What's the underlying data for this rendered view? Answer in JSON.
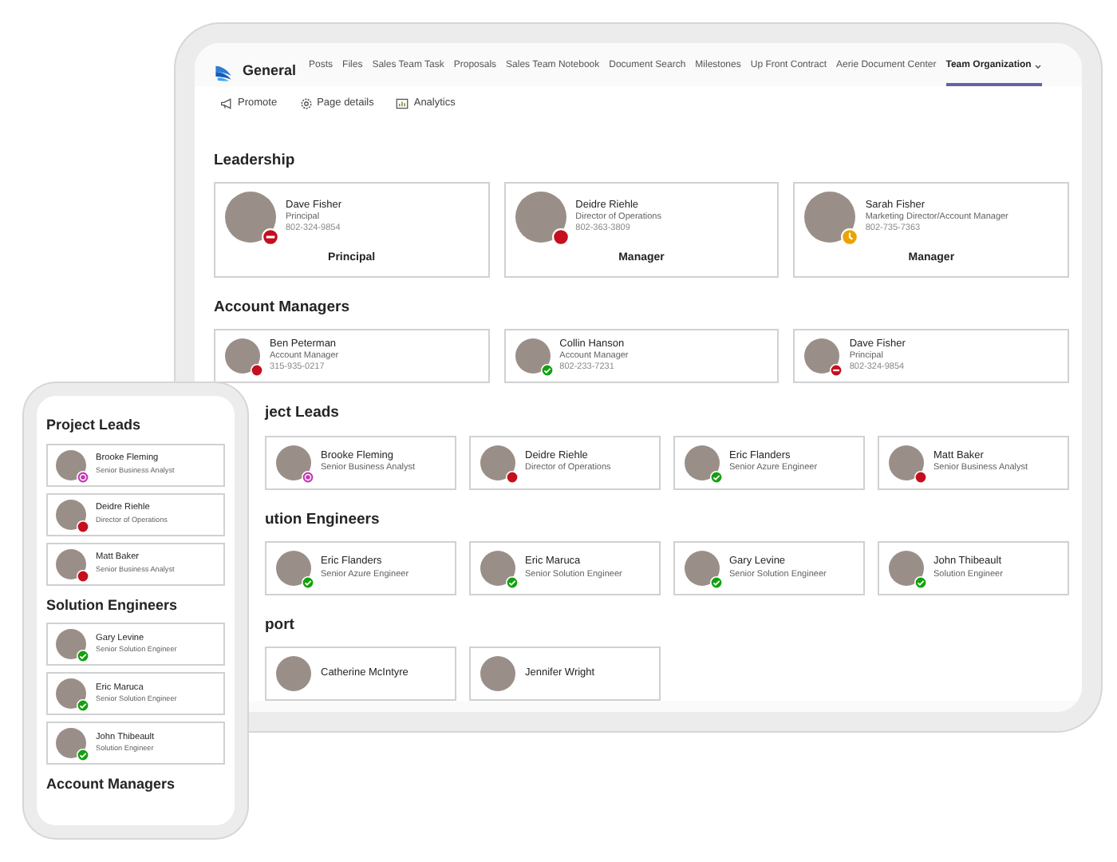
{
  "tablet": {
    "team_name": "General",
    "tabs": [
      {
        "label": "Posts",
        "selected": false
      },
      {
        "label": "Files",
        "selected": false
      },
      {
        "label": "Sales Team Task",
        "selected": false
      },
      {
        "label": "Proposals",
        "selected": false
      },
      {
        "label": "Sales Team Notebook",
        "selected": false
      },
      {
        "label": "Document Search",
        "selected": false
      },
      {
        "label": "Milestones",
        "selected": false
      },
      {
        "label": "Up Front Contract",
        "selected": false
      },
      {
        "label": "Aerie Document Center",
        "selected": false
      },
      {
        "label": "Team Organization",
        "selected": true
      }
    ],
    "toolbar": [
      {
        "kind": "promote",
        "label": "Promote"
      },
      {
        "kind": "details",
        "label": "Page details"
      },
      {
        "kind": "analytics",
        "label": "Analytics"
      }
    ],
    "sections": [
      {
        "title": "Leadership",
        "kind": "wide",
        "people": [
          {
            "name": "Dave Fisher",
            "title": "Principal",
            "phone": "802-324-9854",
            "status": {
              "kind": "dnd",
              "color": "#c50f1f"
            },
            "role": "Principal"
          },
          {
            "name": "Deidre Riehle",
            "title": "Director of Operations",
            "phone": "802-363-3809",
            "status": {
              "kind": "busy",
              "color": "#c50f1f"
            },
            "role": "Manager"
          },
          {
            "name": "Sarah Fisher",
            "title": "Marketing Director/Account Manager",
            "phone": "802-735-7363",
            "status": {
              "kind": "away",
              "color": "#eaa300"
            },
            "role": "Manager"
          }
        ]
      },
      {
        "title": "Account Managers",
        "kind": "wide",
        "people": [
          {
            "name": "Ben Peterman",
            "title": "Account Manager",
            "phone": "315-935-0217",
            "status": {
              "kind": "busy",
              "color": "#c50f1f"
            }
          },
          {
            "name": "Collin Hanson",
            "title": "Account Manager",
            "phone": "802-233-7231",
            "status": {
              "kind": "available",
              "color": "#13a10e"
            }
          },
          {
            "name": "Dave Fisher",
            "title": "Principal",
            "phone": "802-324-9854",
            "status": {
              "kind": "dnd",
              "color": "#c50f1f"
            }
          }
        ]
      },
      {
        "title": "ject Leads",
        "kind": "narrow",
        "people": [
          {
            "name": "Brooke Fleming",
            "title": "Senior Business Analyst",
            "status": {
              "kind": "ooo",
              "color": "#c239b3"
            }
          },
          {
            "name": "Deidre Riehle",
            "title": "Director of Operations",
            "status": {
              "kind": "busy",
              "color": "#c50f1f"
            }
          },
          {
            "name": "Eric Flanders",
            "title": "Senior Azure Engineer",
            "status": {
              "kind": "available",
              "color": "#13a10e"
            }
          },
          {
            "name": "Matt Baker",
            "title": "Senior Business Analyst",
            "status": {
              "kind": "busy",
              "color": "#c50f1f"
            }
          }
        ]
      },
      {
        "title": "ution Engineers",
        "kind": "narrow",
        "people": [
          {
            "name": "Eric Flanders",
            "title": "Senior Azure Engineer",
            "status": {
              "kind": "available",
              "color": "#13a10e"
            }
          },
          {
            "name": "Eric Maruca",
            "title": "Senior Solution Engineer",
            "status": {
              "kind": "available",
              "color": "#13a10e"
            }
          },
          {
            "name": "Gary Levine",
            "title": "Senior Solution Engineer",
            "status": {
              "kind": "available",
              "color": "#13a10e"
            }
          },
          {
            "name": "John Thibeault",
            "title": "Solution Engineer",
            "status": {
              "kind": "available",
              "color": "#13a10e"
            }
          }
        ]
      },
      {
        "title": "port",
        "kind": "narrow",
        "people": [
          {
            "name": "Catherine McIntyre"
          },
          {
            "name": "Jennifer Wright"
          }
        ]
      }
    ]
  },
  "phone": {
    "sections": [
      {
        "title": "Project Leads",
        "people": [
          {
            "name": "Brooke Fleming",
            "title": "Senior Business Analyst",
            "status": {
              "kind": "ooo",
              "color": "#c239b3"
            }
          },
          {
            "name": "Deidre Riehle",
            "title": "Director of Operations",
            "status": {
              "kind": "busy",
              "color": "#c50f1f"
            }
          },
          {
            "name": "Matt Baker",
            "title": "Senior Business Analyst",
            "status": {
              "kind": "busy",
              "color": "#c50f1f"
            }
          }
        ]
      },
      {
        "title": "Solution Engineers",
        "people": [
          {
            "name": "Gary Levine",
            "title": "Senior Solution Engineer",
            "status": {
              "kind": "available",
              "color": "#13a10e"
            }
          },
          {
            "name": "Eric Maruca",
            "title": "Senior Solution Engineer",
            "status": {
              "kind": "available",
              "color": "#13a10e"
            }
          },
          {
            "name": "John Thibeault",
            "title": "Solution Engineer",
            "status": {
              "kind": "available",
              "color": "#13a10e"
            }
          }
        ]
      },
      {
        "title": "Account Managers"
      }
    ]
  }
}
